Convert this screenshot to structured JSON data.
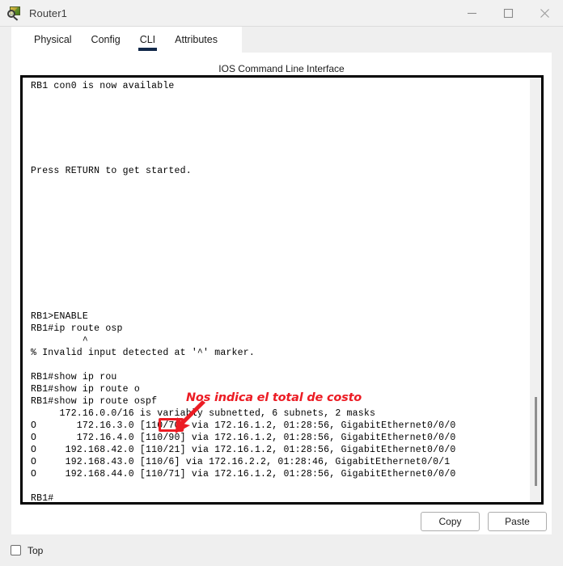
{
  "window": {
    "title": "Router1",
    "icon": "router-magnifier-icon",
    "controls": {
      "minimize": "minimize-icon",
      "maximize": "maximize-icon",
      "close": "close-icon"
    }
  },
  "tabs": [
    {
      "label": "Physical",
      "active": false
    },
    {
      "label": "Config",
      "active": false
    },
    {
      "label": "CLI",
      "active": true
    },
    {
      "label": "Attributes",
      "active": false
    }
  ],
  "panel": {
    "heading": "IOS Command Line Interface"
  },
  "terminal": {
    "text": "RB1 con0 is now available\n\n\n\n\n\n\nPress RETURN to get started.\n\n\n\n\n\n\n\n\n\n\n\nRB1>ENABLE\nRB1#ip route osp\n         ^\n% Invalid input detected at '^' marker.\n\nRB1#show ip rou\nRB1#show ip route o\nRB1#show ip route ospf\n     172.16.0.0/16 is variably subnetted, 6 subnets, 2 masks\nO       172.16.3.0 [110/70] via 172.16.1.2, 01:28:56, GigabitEthernet0/0/0\nO       172.16.4.0 [110/90] via 172.16.1.2, 01:28:56, GigabitEthernet0/0/0\nO     192.168.42.0 [110/21] via 172.16.1.2, 01:28:56, GigabitEthernet0/0/0\nO     192.168.43.0 [110/6] via 172.16.2.2, 01:28:46, GigabitEthernet0/0/1\nO     192.168.44.0 [110/71] via 172.16.1.2, 01:28:56, GigabitEthernet0/0/0\n\nRB1#",
    "scrollbar": "vertical-scrollbar"
  },
  "annotation": {
    "text": "Nos indica el total de costo",
    "color": "#ec1c24",
    "outline_color": "#ffffff",
    "highlighted_value": "70",
    "arrow": "down-left-arrow"
  },
  "buttons": {
    "copy": "Copy",
    "paste": "Paste"
  },
  "bottom": {
    "top_checkbox_label": "Top",
    "top_checked": false
  }
}
